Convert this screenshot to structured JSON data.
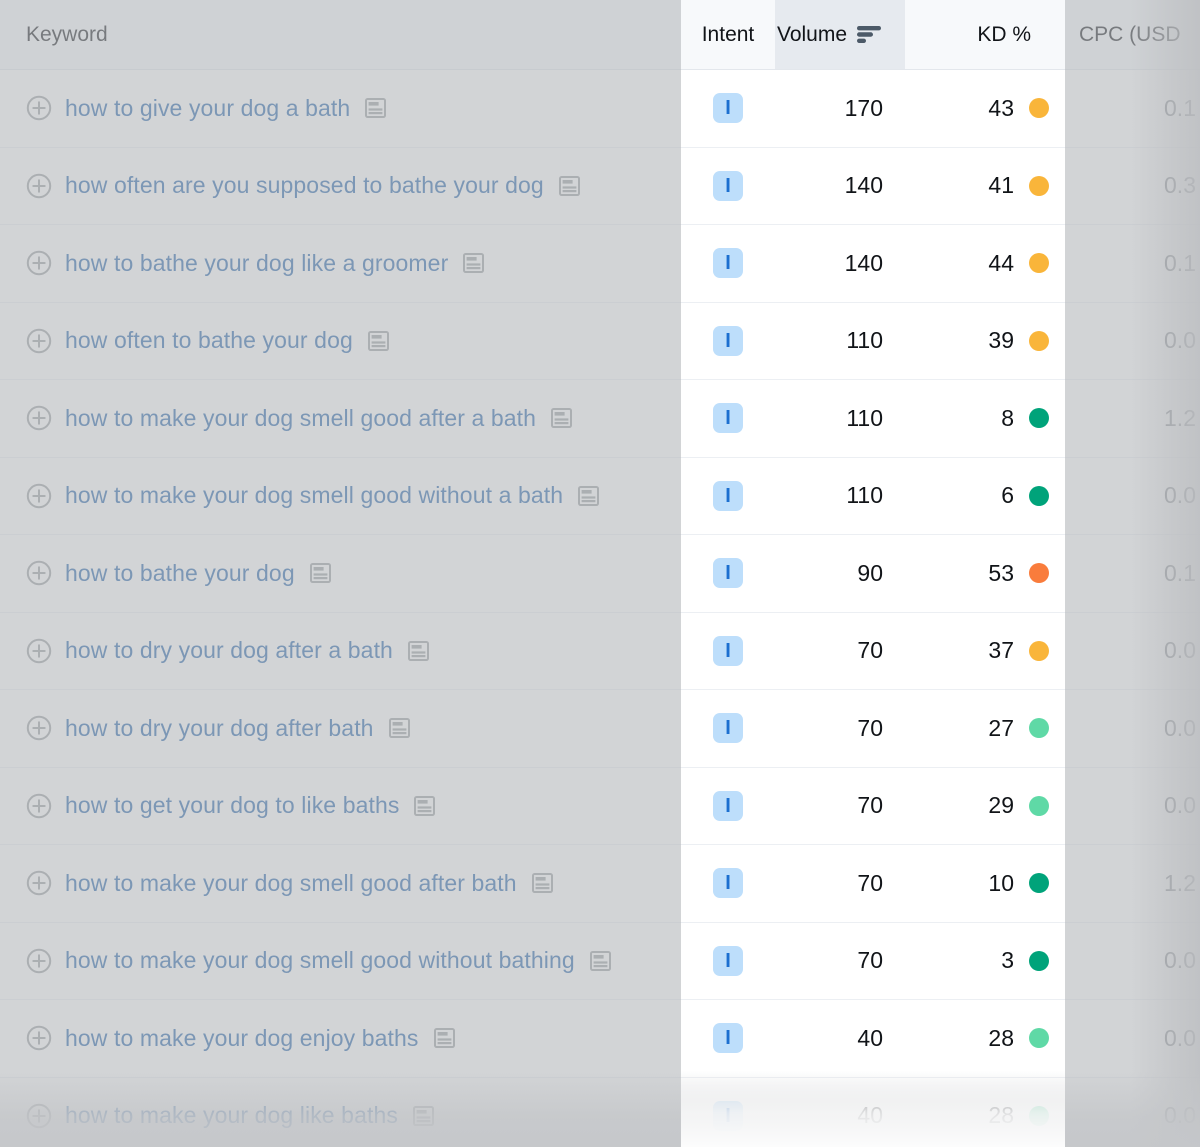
{
  "table": {
    "columns": {
      "keyword": "Keyword",
      "intent": "Intent",
      "volume": "Volume",
      "kd": "KD %",
      "cpc": "CPC (USD"
    },
    "sort": {
      "column": "Volume",
      "icon": "sort-descending-icon"
    },
    "colors": {
      "link": "#1f5fa9",
      "intent_badge_bg": "#bddefb",
      "intent_badge_fg": "#1c6fd0",
      "kd_easy": "#00a37a",
      "kd_light": "#5fd9a6",
      "kd_medium": "#f9b53a",
      "kd_hard": "#f97c3c",
      "header_bg": "#f7f9fb",
      "sorted_header_bg": "#e6eaef",
      "dim_overlay": "#b7babd"
    },
    "rows": [
      {
        "keyword": "how to give your dog a bath",
        "intent": "I",
        "volume": "170",
        "kd": "43",
        "kd_color": "#f9b53a",
        "cpc": "0.1"
      },
      {
        "keyword": "how often are you supposed to bathe your dog",
        "intent": "I",
        "volume": "140",
        "kd": "41",
        "kd_color": "#f9b53a",
        "cpc": "0.3"
      },
      {
        "keyword": "how to bathe your dog like a groomer",
        "intent": "I",
        "volume": "140",
        "kd": "44",
        "kd_color": "#f9b53a",
        "cpc": "0.1"
      },
      {
        "keyword": "how often to bathe your dog",
        "intent": "I",
        "volume": "110",
        "kd": "39",
        "kd_color": "#f9b53a",
        "cpc": "0.0"
      },
      {
        "keyword": "how to make your dog smell good after a bath",
        "intent": "I",
        "volume": "110",
        "kd": "8",
        "kd_color": "#00a37a",
        "cpc": "1.2"
      },
      {
        "keyword": "how to make your dog smell good without a bath",
        "intent": "I",
        "volume": "110",
        "kd": "6",
        "kd_color": "#00a37a",
        "cpc": "0.0"
      },
      {
        "keyword": "how to bathe your dog",
        "intent": "I",
        "volume": "90",
        "kd": "53",
        "kd_color": "#f97c3c",
        "cpc": "0.1"
      },
      {
        "keyword": "how to dry your dog after a bath",
        "intent": "I",
        "volume": "70",
        "kd": "37",
        "kd_color": "#f9b53a",
        "cpc": "0.0"
      },
      {
        "keyword": "how to dry your dog after bath",
        "intent": "I",
        "volume": "70",
        "kd": "27",
        "kd_color": "#5fd9a6",
        "cpc": "0.0"
      },
      {
        "keyword": "how to get your dog to like baths",
        "intent": "I",
        "volume": "70",
        "kd": "29",
        "kd_color": "#5fd9a6",
        "cpc": "0.0"
      },
      {
        "keyword": "how to make your dog smell good after bath",
        "intent": "I",
        "volume": "70",
        "kd": "10",
        "kd_color": "#00a37a",
        "cpc": "1.2"
      },
      {
        "keyword": "how to make your dog smell good without bathing",
        "intent": "I",
        "volume": "70",
        "kd": "3",
        "kd_color": "#00a37a",
        "cpc": "0.0"
      },
      {
        "keyword": "how to make your dog enjoy baths",
        "intent": "I",
        "volume": "40",
        "kd": "28",
        "kd_color": "#5fd9a6",
        "cpc": "0.0"
      },
      {
        "keyword": "how to make your dog like baths",
        "intent": "I",
        "volume": "40",
        "kd": "28",
        "kd_color": "#5fd9a6",
        "cpc": "0.0"
      }
    ]
  }
}
